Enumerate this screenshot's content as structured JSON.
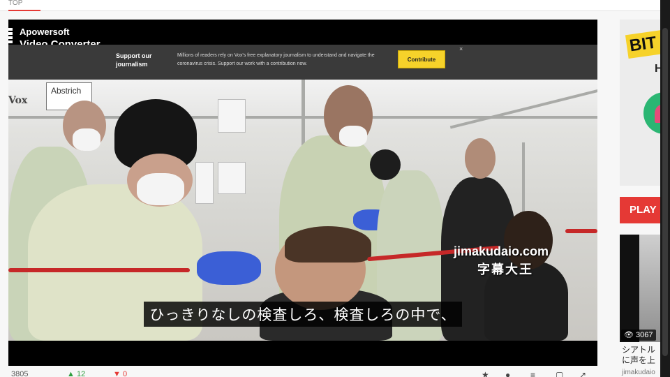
{
  "top_tab": {
    "label": "TOP"
  },
  "player": {
    "watermark_app_line1": "Apowersoft",
    "watermark_app_line2": "Video Converter",
    "banner": {
      "title": "Support our journalism",
      "text": "Millions of readers rely on Vox's free explanatory journalism to understand and navigate the coronavirus crisis. Support our work with a contribution now.",
      "button": "Contribute",
      "close": "×"
    },
    "brand_mark": "Vox",
    "sign_text": "Abstrich",
    "watermark_domain": "jimakudaio.com",
    "watermark_jp": "字幕大王",
    "subtitle": "ひっきりなしの検査しろ、検査しろの中で、"
  },
  "meta": {
    "views": "3805",
    "likes": "12",
    "dislikes": "0"
  },
  "sidebar": {
    "ad_text": "BIT",
    "ad_sub": "H",
    "play_label": "PLAY",
    "thumb_views": "3067",
    "thumb_title_line1": "シアトル",
    "thumb_title_line2": "に声を上",
    "thumb_channel": "jimakudaio"
  },
  "colors": {
    "accent": "#e53935",
    "banner_button": "#f6d22a",
    "glove": "#3b5fd6"
  }
}
